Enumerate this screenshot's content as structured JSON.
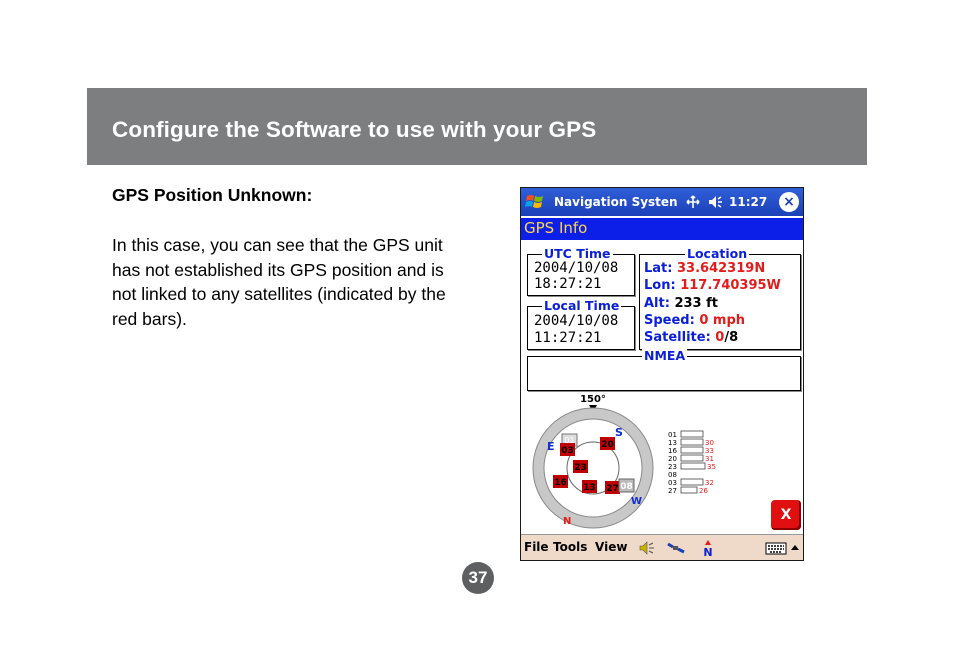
{
  "header": {
    "title": "Configure the Software to use with your GPS"
  },
  "section": {
    "heading": "GPS Position Unknown:",
    "body": "In this case, you can see that the GPS unit has not established its GPS position and is not linked to any satellites (indicated by the red bars)."
  },
  "page_number": "37",
  "device": {
    "taskbar": {
      "app_title": "Navigation Systen",
      "time": "11:27",
      "close_symbol": "×"
    },
    "title": "GPS Info",
    "utc": {
      "legend": "UTC Time",
      "date": "2004/10/08",
      "time": "18:27:21"
    },
    "local": {
      "legend": "Local Time",
      "date": "2004/10/08",
      "time": "11:27:21"
    },
    "location": {
      "legend": "Location",
      "lat_label": "Lat:",
      "lat": "33.642319N",
      "lon_label": "Lon:",
      "lon": "117.740395W",
      "alt_label": "Alt:",
      "alt": "233 ft",
      "speed_label": "Speed:",
      "speed": "0 mph",
      "sat_label": "Satellite:",
      "sat_used": "0",
      "sat_total": "/8"
    },
    "nmea": {
      "legend": "NMEA",
      "value": ""
    },
    "sky": {
      "heading": "150°",
      "directions": {
        "E": "E",
        "S": "S",
        "W": "W",
        "N": "N"
      },
      "satellites": [
        "01",
        "20",
        "03",
        "23",
        "16",
        "13",
        "27",
        "08"
      ]
    },
    "signal": {
      "rows": [
        {
          "id": "01",
          "value": ""
        },
        {
          "id": "13",
          "value": "30"
        },
        {
          "id": "16",
          "value": "33"
        },
        {
          "id": "20",
          "value": "31"
        },
        {
          "id": "23",
          "value": "35"
        },
        {
          "id": "08",
          "value": ""
        },
        {
          "id": "03",
          "value": "32"
        },
        {
          "id": "27",
          "value": "26"
        }
      ]
    },
    "exit_button": "X",
    "menu": {
      "file": "File",
      "tools": "Tools",
      "view": "View"
    },
    "colors": {
      "taskbar": "#1b3fb8",
      "title_bar": "#0b1fe8",
      "title_text": "#ffd54a",
      "label_blue": "#0a1fd6",
      "value_red": "#e21b1b",
      "sat_red": "#cc0000",
      "menu_bg": "#efd9c9"
    }
  }
}
